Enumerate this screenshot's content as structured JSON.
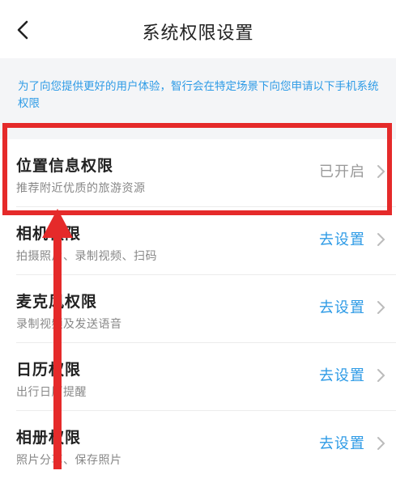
{
  "header": {
    "title": "系统权限设置"
  },
  "notice": {
    "text": "为了向您提供更好的用户体验，智行会在特定场景下向您申请以下手机系统权限"
  },
  "permissions": [
    {
      "name": "位置信息权限",
      "desc": "推荐附近优质的旅游资源",
      "action": "已开启"
    },
    {
      "name": "相机权限",
      "desc": "拍摄照片、录制视频、扫码",
      "action": "去设置"
    },
    {
      "name": "麦克风权限",
      "desc": "录制视频及发送语音",
      "action": "去设置"
    },
    {
      "name": "日历权限",
      "desc": "出行日历提醒",
      "action": "去设置"
    },
    {
      "name": "相册权限",
      "desc": "照片分享、保存照片",
      "action": "去设置"
    }
  ],
  "colors": {
    "accent": "#2e9be6",
    "highlight": "#e52a2a",
    "muted": "#999999"
  },
  "icons": {
    "back": "back-arrow-icon",
    "chevron": "chevron-right-icon",
    "annotation": "red-arrow-icon"
  }
}
